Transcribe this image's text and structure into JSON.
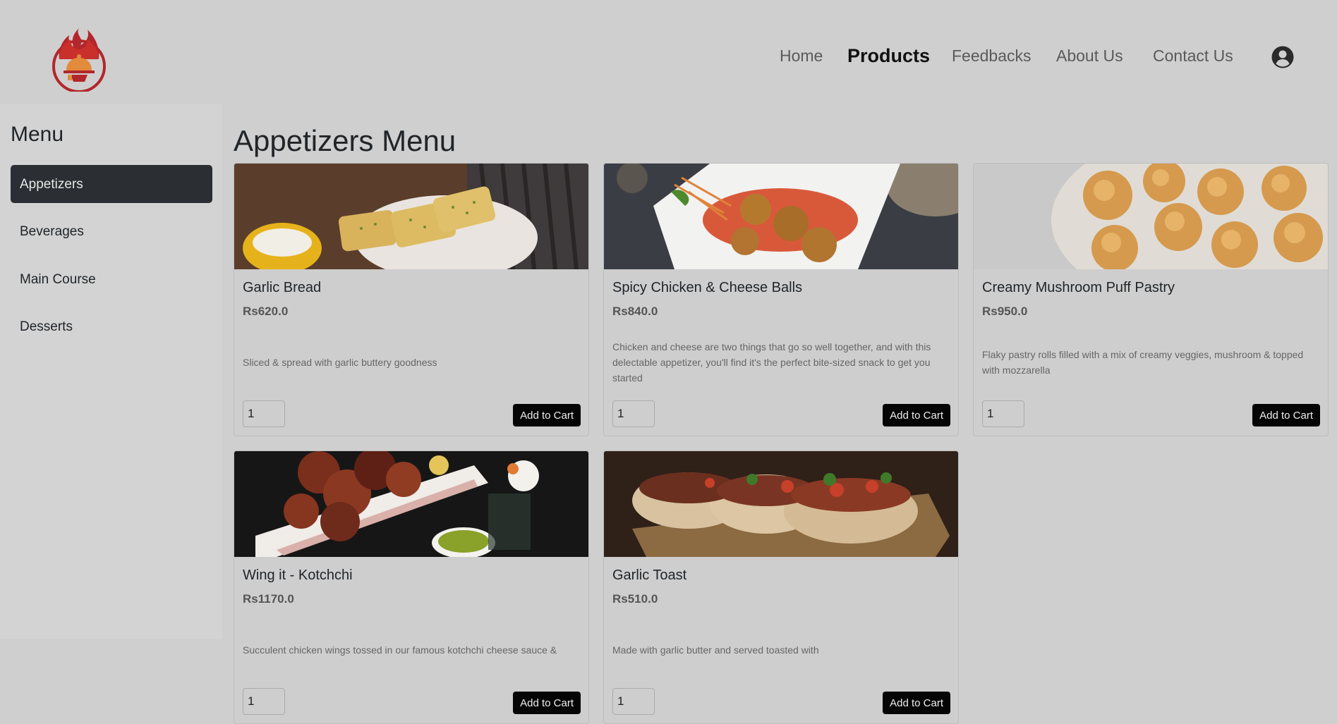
{
  "nav": {
    "items": [
      "Home",
      "Products",
      "Feedbacks",
      "About Us",
      "Contact Us"
    ],
    "active": "Products"
  },
  "sidebar": {
    "title": "Menu",
    "items": [
      "Appetizers",
      "Beverages",
      "Main Course",
      "Desserts"
    ],
    "active": "Appetizers"
  },
  "main": {
    "title": "Appetizers Menu",
    "add_label": "Add to Cart",
    "products": [
      {
        "name": "Garlic Bread",
        "price": "Rs620.0",
        "description": "Sliced & spread with garlic buttery goodness",
        "qty": "1",
        "image": "garlic-bread"
      },
      {
        "name": "Spicy Chicken & Cheese Balls",
        "price": "Rs840.0",
        "description": "Chicken and cheese are two things that go so well together, and with this delectable appetizer, you'll find it's the perfect bite-sized snack to get you started",
        "qty": "1",
        "image": "cheese-balls"
      },
      {
        "name": "Creamy Mushroom Puff Pastry",
        "price": "Rs950.0",
        "description": "Flaky pastry rolls filled with a mix of creamy veggies, mushroom & topped with mozzarella",
        "qty": "1",
        "image": "puff-pastry"
      },
      {
        "name": "Wing it - Kotchchi",
        "price": "Rs1170.0",
        "description": "Succulent chicken wings tossed in our famous kotchchi cheese sauce &",
        "qty": "1",
        "image": "chicken-wings"
      },
      {
        "name": "Garlic Toast",
        "price": "Rs510.0",
        "description": "Made with garlic butter and served toasted with",
        "qty": "1",
        "image": "garlic-toast"
      }
    ]
  },
  "colors": {
    "background": "#cfcfcf",
    "active_sidebar": "#2b2f33",
    "button": "#050505",
    "logo": "#b3262b"
  }
}
